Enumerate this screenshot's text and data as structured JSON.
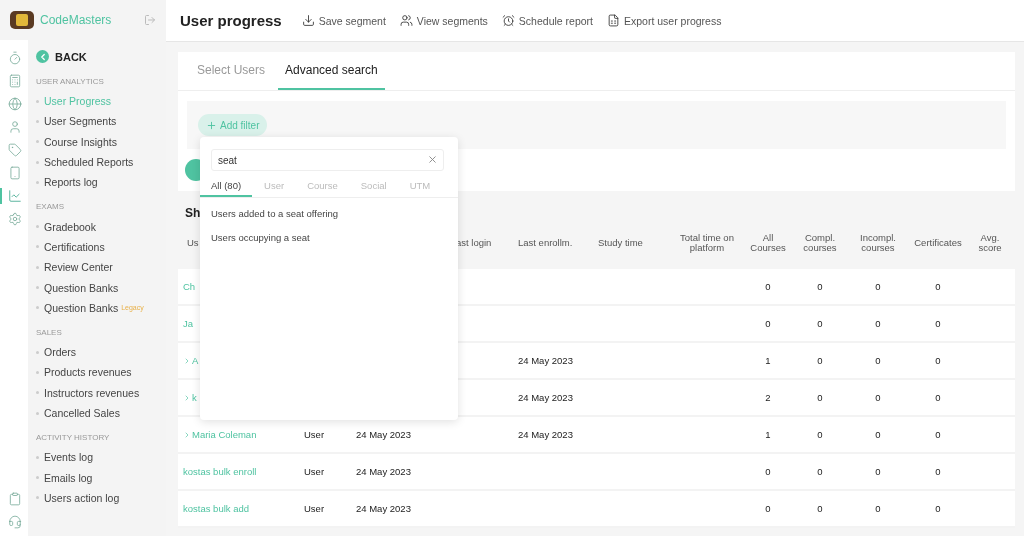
{
  "brand": {
    "name": "CodeMasters"
  },
  "rail": {
    "top": [
      {
        "selected": false
      },
      {
        "selected": false
      },
      {
        "selected": false
      },
      {
        "selected": false
      },
      {
        "selected": false
      },
      {
        "selected": false
      },
      {
        "selected": true
      },
      {
        "selected": false
      }
    ],
    "bottom": [
      {
        "selected": false
      },
      {
        "selected": false
      }
    ]
  },
  "back": {
    "label": "BACK"
  },
  "menu": [
    {
      "heading": "USER ANALYTICS",
      "items": [
        {
          "label": "User Progress",
          "selected": true
        },
        {
          "label": "User Segments",
          "selected": false
        },
        {
          "label": "Course Insights",
          "selected": false
        },
        {
          "label": "Scheduled Reports",
          "selected": false
        },
        {
          "label": "Reports log",
          "selected": false
        }
      ]
    },
    {
      "heading": "EXAMS",
      "items": [
        {
          "label": "Gradebook",
          "selected": false
        },
        {
          "label": "Certifications",
          "selected": false
        },
        {
          "label": "Review Center",
          "selected": false
        },
        {
          "label": "Question Banks",
          "selected": false
        },
        {
          "label": "Question Banks",
          "badge": "Legacy",
          "selected": false
        }
      ]
    },
    {
      "heading": "SALES",
      "items": [
        {
          "label": "Orders",
          "selected": false
        },
        {
          "label": "Products revenues",
          "selected": false
        },
        {
          "label": "Instructors revenues",
          "selected": false
        },
        {
          "label": "Cancelled Sales",
          "selected": false
        }
      ]
    },
    {
      "heading": "ACTIVITY HISTORY",
      "items": [
        {
          "label": "Events log",
          "selected": false
        },
        {
          "label": "Emails log",
          "selected": false
        },
        {
          "label": "Users action log",
          "selected": false
        }
      ]
    }
  ],
  "header": {
    "title": "User progress",
    "actions": [
      {
        "kind": "save",
        "label": "Save segment"
      },
      {
        "kind": "view",
        "label": "View segments"
      },
      {
        "kind": "schedule",
        "label": "Schedule report"
      },
      {
        "kind": "export",
        "label": "Export user progress"
      }
    ]
  },
  "tabs": [
    {
      "label": "Select Users",
      "selected": false
    },
    {
      "label": "Advanced search",
      "selected": true
    }
  ],
  "add_filter": {
    "label": "Add filter"
  },
  "section_title": "Sh",
  "table": {
    "columns": {
      "name": "Us",
      "last_login": "ast login",
      "last_enrollment": "Last enrollm.",
      "study_time": "Study time",
      "total_time": "Total time on platform",
      "all_courses": "All Courses",
      "completed": "Compl. courses",
      "incomplete": "Incompl. courses",
      "certificates": "Certificates",
      "avg_score": "Avg. score"
    },
    "rows": [
      {
        "name": "Ch",
        "expandable": false,
        "all_courses": "0",
        "completed": "0",
        "incomplete": "0",
        "certificates": "0"
      },
      {
        "name": "Ja",
        "expandable": false,
        "all_courses": "0",
        "completed": "0",
        "incomplete": "0",
        "certificates": "0"
      },
      {
        "name": "A",
        "expandable": true,
        "last_enrollment": "24 May 2023",
        "all_courses": "1",
        "completed": "0",
        "incomplete": "0",
        "certificates": "0"
      },
      {
        "name": "k",
        "expandable": true,
        "last_enrollment": "24 May 2023",
        "all_courses": "2",
        "completed": "0",
        "incomplete": "0",
        "certificates": "0"
      },
      {
        "name": "Maria Coleman",
        "expandable": true,
        "type": "User",
        "registered": "24 May 2023",
        "last_enrollment": "24 May 2023",
        "all_courses": "1",
        "completed": "0",
        "incomplete": "0",
        "certificates": "0"
      },
      {
        "name": "kostas bulk enroll",
        "expandable": false,
        "type": "User",
        "registered": "24 May 2023",
        "all_courses": "0",
        "completed": "0",
        "incomplete": "0",
        "certificates": "0"
      },
      {
        "name": "kostas bulk add",
        "expandable": false,
        "type": "User",
        "registered": "24 May 2023",
        "all_courses": "0",
        "completed": "0",
        "incomplete": "0",
        "certificates": "0"
      }
    ]
  },
  "filter_popup": {
    "search": {
      "value": "seat"
    },
    "tabs": [
      {
        "label": "All (80)",
        "selected": true
      },
      {
        "label": "User",
        "selected": false
      },
      {
        "label": "Course",
        "selected": false
      },
      {
        "label": "Social",
        "selected": false
      },
      {
        "label": "UTM",
        "selected": false
      }
    ],
    "results": [
      "Users added to a seat offering",
      "Users occupying a seat"
    ]
  }
}
